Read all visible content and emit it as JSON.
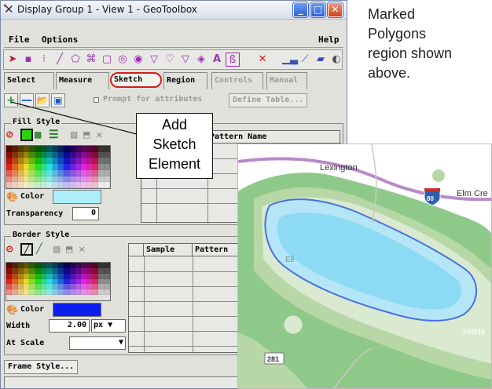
{
  "window": {
    "title": "Display Group 1 - View 1 - GeoToolbox",
    "controls": {
      "minimize": "_",
      "maximize": "□",
      "close": "✕"
    }
  },
  "menu": {
    "file": "File",
    "options": "Options",
    "help": "Help"
  },
  "icon_bar": [
    "arrow-select-icon",
    "point-icon",
    "dotted-rect-icon",
    "line-icon",
    "polygon-icon",
    "freehand-polygon-icon",
    "rectangle-icon",
    "circle-icon",
    "ellipse-icon",
    "arc-icon",
    "pie-icon",
    "sector-icon",
    "text-icon",
    "symbol-icon",
    "clear-icon",
    "histogram-icon",
    "chart-icon",
    "map-icon",
    "pie-chart-icon"
  ],
  "tabs": [
    {
      "label": "Select",
      "state": "normal"
    },
    {
      "label": "Measure",
      "state": "normal"
    },
    {
      "label": "Sketch",
      "state": "active"
    },
    {
      "label": "Region",
      "state": "normal"
    },
    {
      "label": "Controls",
      "state": "disabled"
    },
    {
      "label": "Manual",
      "state": "disabled"
    }
  ],
  "sketch_tools": {
    "add_icon": "+",
    "remove_icon": "—",
    "open_icon": "folder-open-icon",
    "save_icon": "floppy-save-icon",
    "prompt_label": "Prompt for attributes",
    "prompt_checked": false,
    "define_table": "Define Table..."
  },
  "fill_style": {
    "label": "Fill Style",
    "color_label": "Color",
    "color_value": "#aeeefb",
    "transparency_label": "Transparency",
    "transparency_value": "0",
    "table_header": "Pattern Name"
  },
  "border_style": {
    "label": "Border Style",
    "color_label": "Color",
    "color_value": "#0d1ef0",
    "width_label": "Width",
    "width_value": "2.00",
    "width_unit": "px",
    "at_scale_label": "At Scale",
    "at_scale_value": "",
    "table_headers": [
      "Sample",
      "Pattern"
    ]
  },
  "frame_style_button": "Frame Style...",
  "callout": {
    "lines": [
      "Add",
      "Sketch",
      "Element"
    ]
  },
  "caption": {
    "lines": [
      "Marked",
      "Polygons",
      "region shown",
      "above."
    ]
  },
  "map": {
    "labels": {
      "town1": "Lexington",
      "town2": "Elm Cre",
      "lake_partial": "Ell",
      "town3": "Holde",
      "route_280": "281",
      "shield_80": "80"
    },
    "colors": {
      "outer": "#8fc98a",
      "mid": "#b7d8a6",
      "light": "#d9ead0",
      "lake": "#b4e6f8",
      "border": "#4a6fe0",
      "road": "#b98acb"
    }
  }
}
